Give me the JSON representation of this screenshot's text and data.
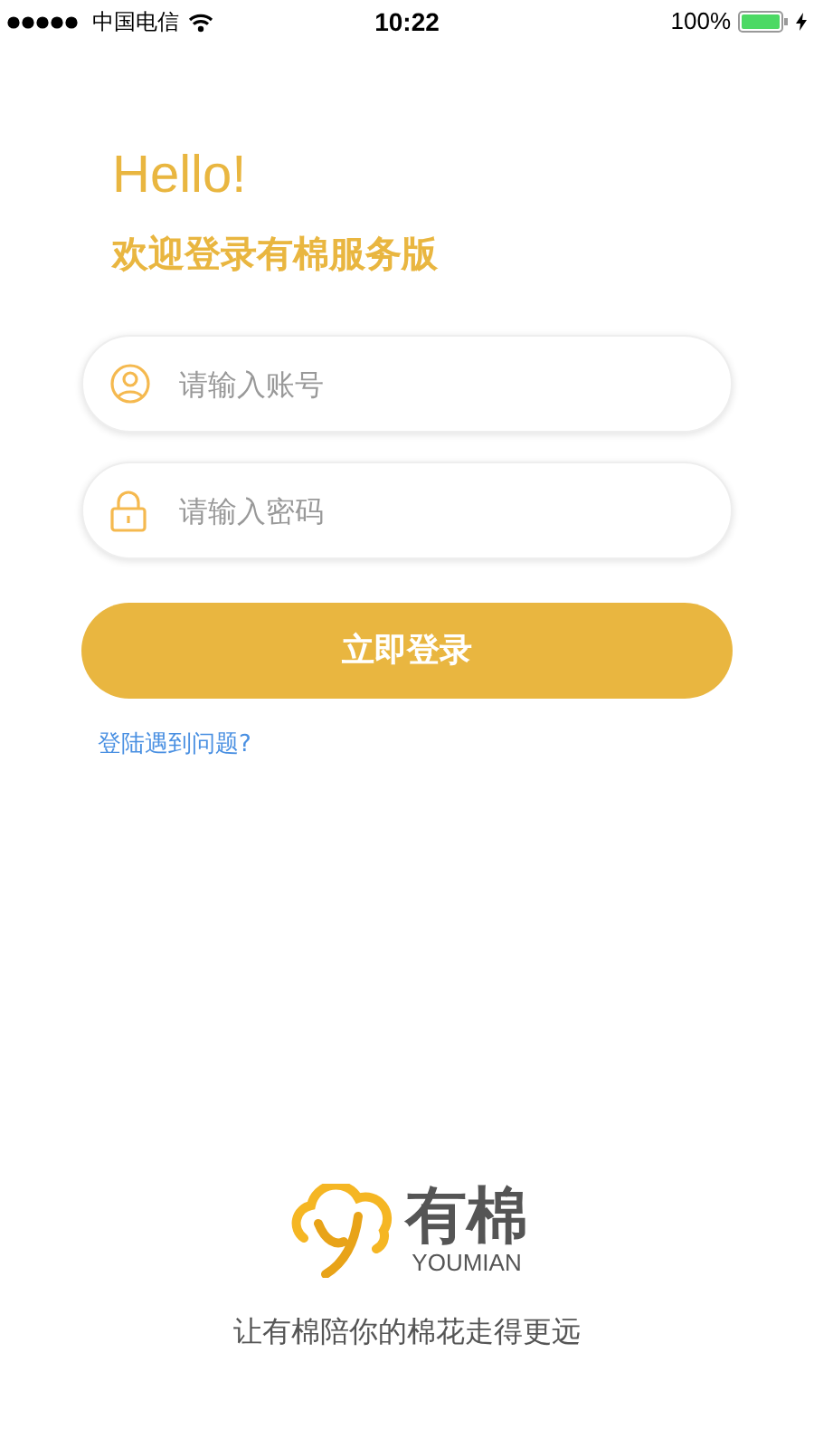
{
  "status_bar": {
    "carrier": "中国电信",
    "time": "10:22",
    "battery": "100%"
  },
  "greeting": {
    "title": "Hello!",
    "subtitle": "欢迎登录有棉服务版"
  },
  "fields": [
    {
      "kind": "account",
      "placeholder": "请输入账号"
    },
    {
      "kind": "password",
      "placeholder": "请输入密码"
    }
  ],
  "login_button": "立即登录",
  "help_link": "登陆遇到问题?",
  "logo": {
    "name": "有棉",
    "latin": "YOUMIAN"
  },
  "tagline": "让有棉陪你的棉花走得更远"
}
